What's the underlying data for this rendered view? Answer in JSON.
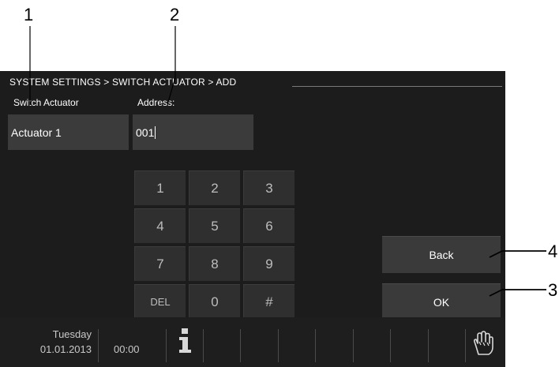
{
  "callouts": {
    "n1": "1",
    "n2": "2",
    "n3": "3",
    "n4": "4"
  },
  "header": {
    "breadcrumb": "SYSTEM SETTINGS > SWITCH ACTUATOR > ADD"
  },
  "form": {
    "switch_actuator_label": "Switch Actuator",
    "address_label": "Address:",
    "switch_actuator_value": "Actuator 1",
    "address_value": "001"
  },
  "keypad": {
    "keys": [
      "1",
      "2",
      "3",
      "4",
      "5",
      "6",
      "7",
      "8",
      "9",
      "DEL",
      "0",
      "#"
    ]
  },
  "actions": {
    "back_label": "Back",
    "ok_label": "OK"
  },
  "taskbar": {
    "day": "Tuesday",
    "date": "01.01.2013",
    "time": "00:00",
    "info_icon": "info-icon",
    "hand_icon": "hand-icon"
  },
  "colors": {
    "screen_bg": "#1c1c1c",
    "field_bg": "#3b3b3b",
    "key_bg": "#2f2f2f",
    "text": "#ffffff"
  }
}
